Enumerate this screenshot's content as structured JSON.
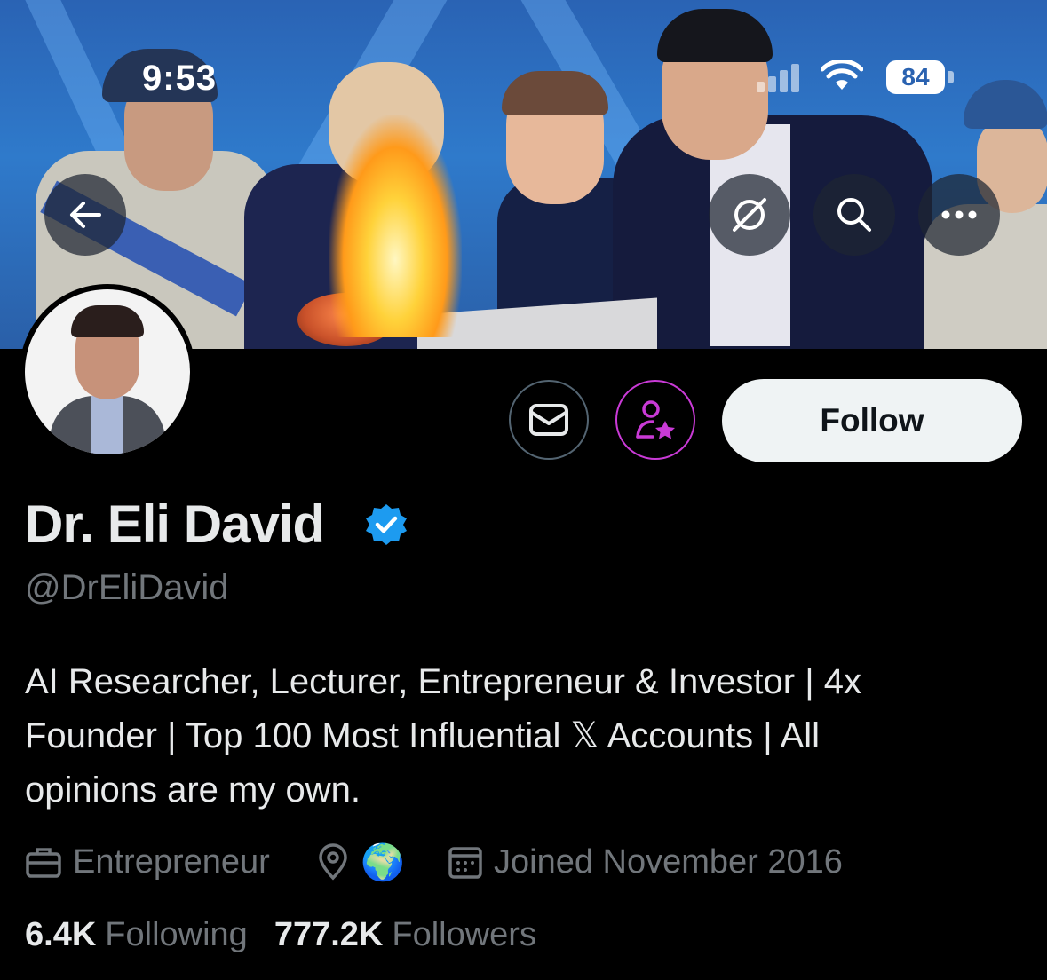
{
  "status_bar": {
    "time": "9:53",
    "battery": "84"
  },
  "header": {
    "back_icon": "arrow-left-icon",
    "grok_icon": "grok-icon",
    "search_icon": "search-icon",
    "more_icon": "more-horizontal-icon"
  },
  "actions": {
    "message_icon": "envelope-icon",
    "subscribe_icon": "person-star-icon",
    "follow_label": "Follow"
  },
  "profile": {
    "display_name": "Dr. Eli David",
    "handle": "@DrEliDavid",
    "bio_line1": "AI Researcher, Lecturer, Entrepreneur & Investor | 4x",
    "bio_line2": "Founder | Top 100 Most Influential 𝕏 Accounts | All",
    "bio_line3": "opinions are my own.",
    "profession": "Entrepreneur",
    "location": "🌍",
    "joined": "Joined November 2016",
    "following_count": "6.4K",
    "following_label": "Following",
    "followers_count": "777.2K",
    "followers_label": "Followers"
  },
  "colors": {
    "verified_blue": "#1d9bf0",
    "subscribe_purple": "#c93ad6",
    "muted_text": "#71767b"
  }
}
